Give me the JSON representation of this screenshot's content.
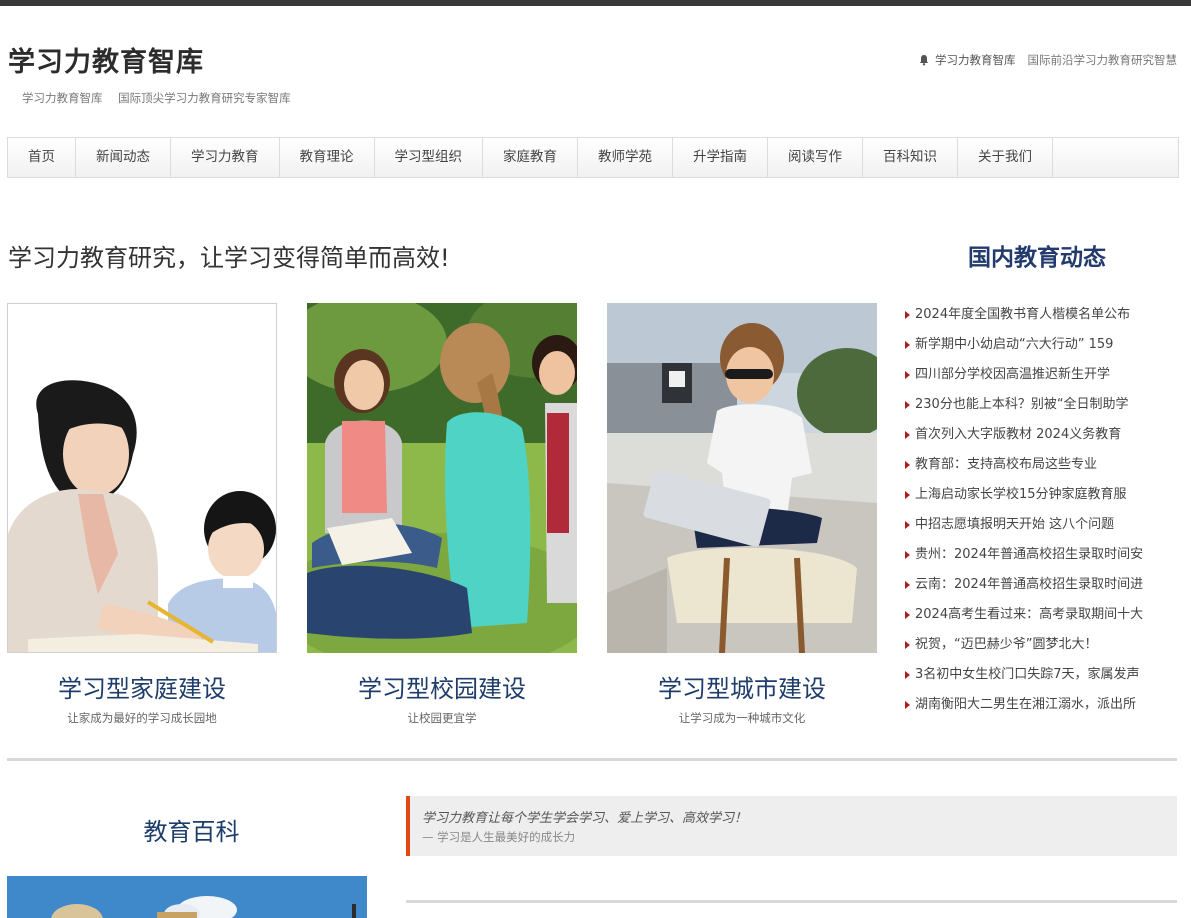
{
  "site": {
    "title": "学习力教育智库",
    "subtitle_name": "学习力教育智库",
    "subtitle_slogan": "国际顶尖学习力教育研究专家智库",
    "right_name": "学习力教育智库",
    "right_slogan": "国际前沿学习力教育研究智慧"
  },
  "nav": {
    "items": [
      "首页",
      "新闻动态",
      "学习力教育",
      "教育理论",
      "学习型组织",
      "家庭教育",
      "教师学苑",
      "升学指南",
      "阅读写作",
      "百科知识",
      "关于我们"
    ]
  },
  "headline": "学习力教育研究，让学习变得简单而高效!",
  "cards": [
    {
      "title": "学习型家庭建设",
      "desc": "让家成为最好的学习成长园地"
    },
    {
      "title": "学习型校园建设",
      "desc": "让校园更宜学"
    },
    {
      "title": "学习型城市建设",
      "desc": "让学习成为一种城市文化"
    }
  ],
  "news": {
    "title": "国内教育动态",
    "items": [
      "2024年度全国教书育人楷模名单公布",
      "新学期中小幼启动“六大行动” 159",
      "四川部分学校因高温推迟新生开学",
      "230分也能上本科？别被“全日制助学",
      "首次列入大字版教材 2024义务教育",
      "教育部：支持高校布局这些专业",
      "上海启动家长学校15分钟家庭教育服",
      "中招志愿填报明天开始 这八个问题",
      "贵州：2024年普通高校招生录取时间安",
      "云南：2024年普通高校招生录取时间进",
      "2024高考生看过来：高考录取期间十大",
      "祝贺，“迈巴赫少爷”圆梦北大！",
      "3名初中女生校门口失踪7天，家属发声",
      "湖南衡阳大二男生在湘江溺水，派出所"
    ]
  },
  "baike": {
    "title": "教育百科"
  },
  "quote": {
    "main": "学习力教育让每个学生学会学习、爱上学习、高效学习！",
    "sub": "— 学习是人生最美好的成长力"
  },
  "colors": {
    "accent": "#e04a12",
    "heading_blue": "#1f3d6b",
    "news_arrow": "#b11d1d"
  }
}
